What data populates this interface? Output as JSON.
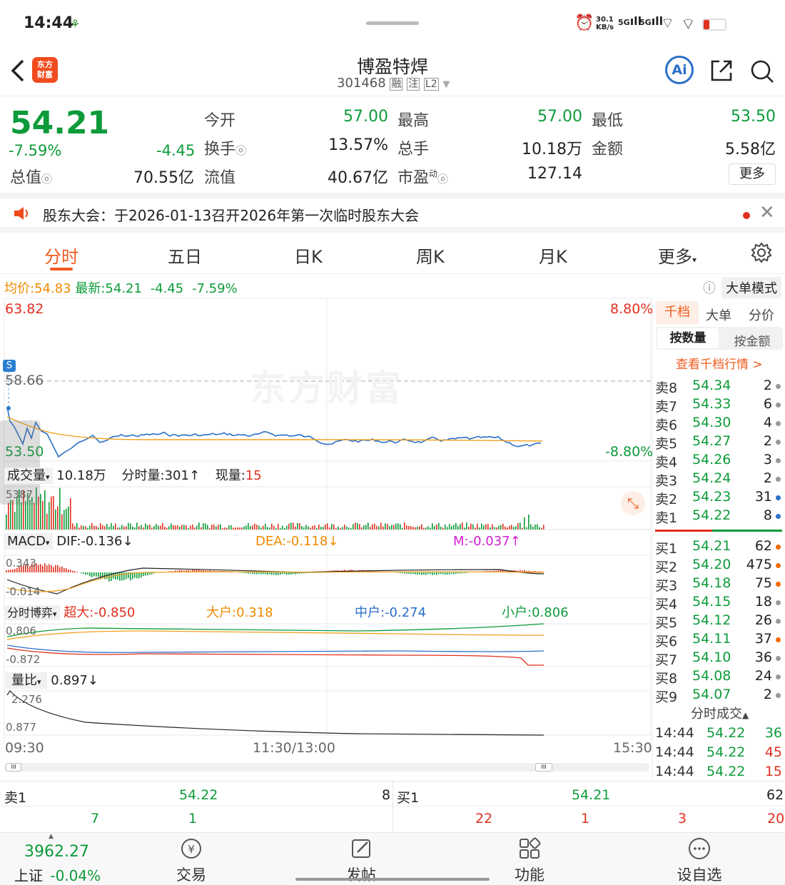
{
  "status": {
    "time": "14:44",
    "net_speed": "30.1",
    "net_unit": "KB/s",
    "sig1": "5G",
    "sig2": "5G"
  },
  "nav": {
    "title": "博盈特焊",
    "code": "301468",
    "tags": [
      "融",
      "注",
      "L2"
    ],
    "logo_line1": "东方",
    "logo_line2": "财富",
    "ai": "Ai"
  },
  "quote": {
    "price": "54.21",
    "pct": "-7.59%",
    "change": "-4.45",
    "rows": [
      {
        "l1": "今开",
        "v1": "57.00",
        "l2": "最高",
        "v2": "57.00",
        "l3": "最低",
        "v3": "53.50"
      },
      {
        "l1": "换手",
        "v1": "13.57%",
        "l2": "总手",
        "v2": "10.18万",
        "l3": "金额",
        "v3": "5.58亿"
      },
      {
        "l0": "总值",
        "v0": "70.55亿",
        "l1": "流值",
        "v1": "40.67亿",
        "l2": "市盈",
        "l2sup": "动",
        "v2": "127.14",
        "more": "更多"
      }
    ]
  },
  "notice": {
    "text": "股东大会：于2026-01-13召开2026年第一次临时股东大会"
  },
  "tabs": [
    "分时",
    "五日",
    "日K",
    "周K",
    "月K",
    "更多"
  ],
  "info_line": {
    "avg_label": "均价:",
    "avg": "54.83",
    "last_label": "最新:",
    "last": "54.21",
    "chg": "-4.45",
    "pct": "-7.59%",
    "mode": "大单模式"
  },
  "main_chart": {
    "top": "63.82",
    "top_pct": "8.80%",
    "mid": "58.66",
    "bottom": "53.50",
    "bottom_pct": "-8.80%",
    "watermark": "东方财富",
    "marker": "S"
  },
  "volume": {
    "label": "成交量",
    "total": "10.18万",
    "fen_label": "分时量:301",
    "fen_arrow": "↑",
    "now_label": "现量:",
    "now": "15",
    "max": "5387"
  },
  "macd": {
    "label": "MACD",
    "dif": "DIF:-0.136",
    "dif_arrow": "↓",
    "dea": "DEA:-0.118",
    "dea_arrow": "↓",
    "m": "M:-0.037",
    "m_arrow": "↑",
    "top": "0.343",
    "bottom": "-0.014"
  },
  "game": {
    "label": "分时博弈",
    "super": "超大:-0.850",
    "big": "大户:0.318",
    "mid": "中户:-0.274",
    "small": "小户:0.806",
    "top": "0.806",
    "bottom": "-0.872"
  },
  "ratio": {
    "label": "量比",
    "value": "0.897",
    "arrow": "↓",
    "top": "2.276",
    "bottom": "0.877"
  },
  "time_axis": [
    "09:30",
    "11:30/13:00",
    "15:30"
  ],
  "book": {
    "tabs": [
      "千档",
      "大单",
      "分价"
    ],
    "sub_tabs": [
      "按数量",
      "按金额"
    ],
    "link": "查看千档行情 >",
    "asks": [
      {
        "l": "卖8",
        "p": "54.34",
        "v": "2",
        "c": "#999"
      },
      {
        "l": "卖7",
        "p": "54.33",
        "v": "6",
        "c": "#999"
      },
      {
        "l": "卖6",
        "p": "54.30",
        "v": "4",
        "c": "#999"
      },
      {
        "l": "卖5",
        "p": "54.27",
        "v": "2",
        "c": "#999"
      },
      {
        "l": "卖4",
        "p": "54.26",
        "v": "3",
        "c": "#999"
      },
      {
        "l": "卖3",
        "p": "54.24",
        "v": "2",
        "c": "#999"
      },
      {
        "l": "卖2",
        "p": "54.23",
        "v": "31",
        "c": "#2a6fc9"
      },
      {
        "l": "卖1",
        "p": "54.22",
        "v": "8",
        "c": "#2a6fc9"
      }
    ],
    "bids": [
      {
        "l": "买1",
        "p": "54.21",
        "v": "62",
        "c": "#f06a00"
      },
      {
        "l": "买2",
        "p": "54.20",
        "v": "475",
        "c": "#f06a00"
      },
      {
        "l": "买3",
        "p": "54.18",
        "v": "75",
        "c": "#f06a00"
      },
      {
        "l": "买4",
        "p": "54.15",
        "v": "18",
        "c": "#999"
      },
      {
        "l": "买5",
        "p": "54.12",
        "v": "26",
        "c": "#999"
      },
      {
        "l": "买6",
        "p": "54.11",
        "v": "37",
        "c": "#f06a00"
      },
      {
        "l": "买7",
        "p": "54.10",
        "v": "36",
        "c": "#999"
      },
      {
        "l": "买8",
        "p": "54.08",
        "v": "24",
        "c": "#999"
      },
      {
        "l": "买9",
        "p": "54.07",
        "v": "2",
        "c": "#999"
      }
    ],
    "trades_label": "分时成交",
    "trades": [
      {
        "t": "14:44",
        "p": "54.22",
        "v": "36"
      },
      {
        "t": "14:44",
        "p": "54.22",
        "v": "45"
      },
      {
        "t": "14:44",
        "p": "54.22",
        "v": "15"
      }
    ]
  },
  "bottom_quote": {
    "sell_label": "卖1",
    "sell_price": "54.22",
    "sell_vol": "8",
    "buy_label": "买1",
    "buy_price": "54.21",
    "buy_vol": "62",
    "sell_nums": [
      "7",
      "1"
    ],
    "buy_nums": [
      "22",
      "1",
      "3",
      "20"
    ]
  },
  "bottom_bar": {
    "index": "3962.27",
    "index_name": "上证",
    "index_pct": "-0.04%",
    "items": [
      "交易",
      "发帖",
      "功能",
      "设自选"
    ]
  }
}
